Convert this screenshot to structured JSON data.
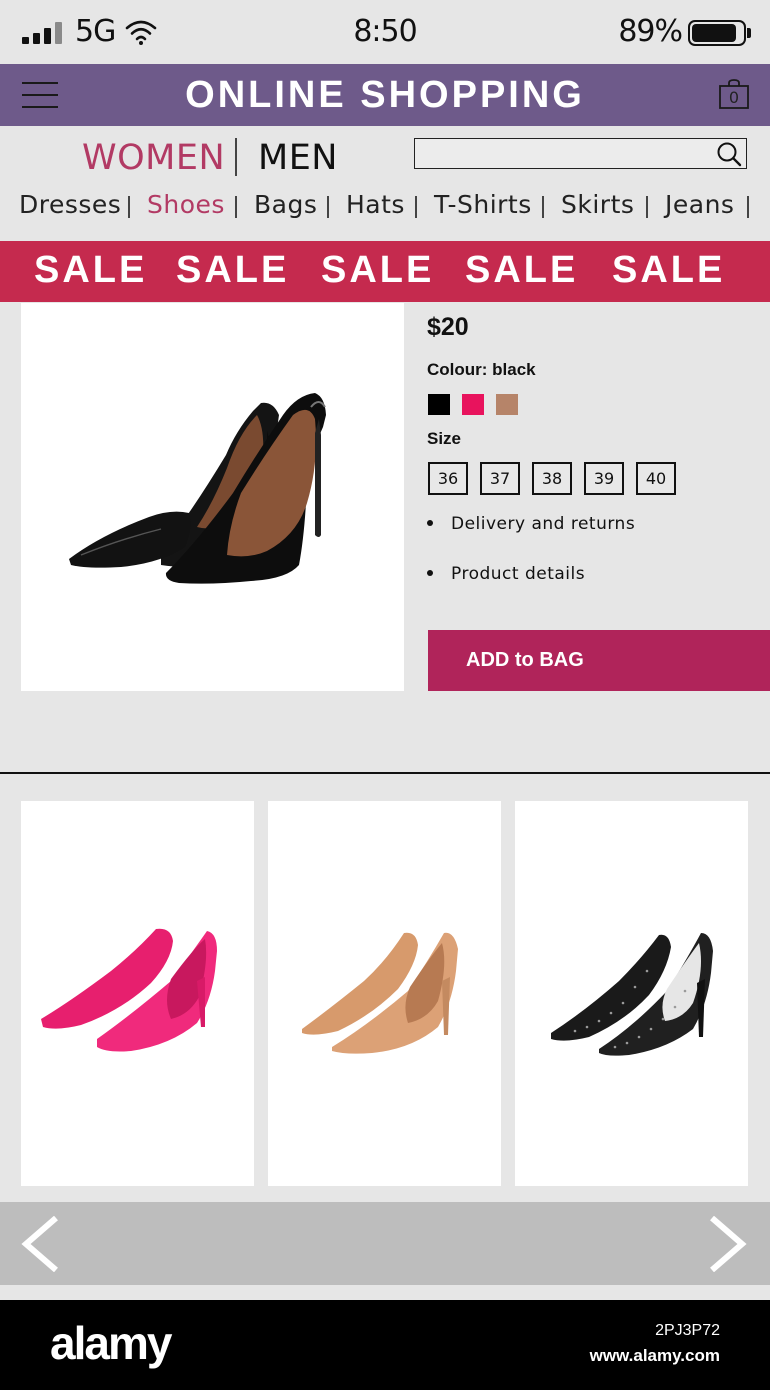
{
  "status_bar": {
    "network": "5G",
    "time": "8:50",
    "battery_percent": "89%",
    "battery_level": 0.89
  },
  "header": {
    "title": "ONLINE SHOPPING",
    "bag_count": "0",
    "menu_icon": "hamburger-menu-icon",
    "bag_icon": "shopping-bag-icon"
  },
  "gender_tabs": {
    "women": "WOMEN",
    "men": "MEN",
    "active": "women"
  },
  "search": {
    "placeholder": "",
    "value": "",
    "icon": "search-icon"
  },
  "categories": {
    "active": "Shoes",
    "items": [
      "Dresses",
      "Shoes",
      "Bags",
      "Hats",
      "T-Shirts",
      "Skirts",
      "Jeans"
    ]
  },
  "sale_banner": {
    "words": [
      "SALE",
      "SALE",
      "SALE",
      "SALE",
      "SALE"
    ]
  },
  "product": {
    "price": "$20",
    "colour_label": "Colour: black",
    "colours": [
      "#000000",
      "#e8135d",
      "#b68469"
    ],
    "size_label": "Size",
    "sizes": [
      "36",
      "37",
      "38",
      "39",
      "40"
    ],
    "info_links": [
      "Delivery and returns",
      "Product details"
    ],
    "add_to_bag": "ADD to BAG"
  },
  "related_products": [
    {
      "image": "pink suede high-heel pumps",
      "color": "#ef2a7a"
    },
    {
      "image": "beige suede high-heel pumps",
      "color": "#d69a6e"
    },
    {
      "image": "black rhinestone high-heel pumps",
      "color": "#1a1a1a"
    }
  ],
  "carousel": {
    "prev_icon": "chevron-left-icon",
    "next_icon": "chevron-right-icon"
  },
  "footer": {
    "logo": "alamy",
    "image_id": "2PJ3P72",
    "url": "www.alamy.com"
  },
  "colors": {
    "header_bg": "#6e5a8a",
    "accent": "#b23a64",
    "sale_bg": "#c52a4e",
    "add_to_bag_bg": "#b0245a",
    "page_bg": "#e6e6e6"
  }
}
